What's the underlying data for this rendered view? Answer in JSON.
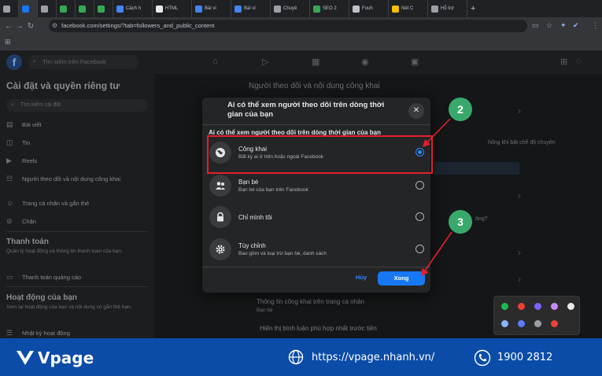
{
  "browser": {
    "tabs": [
      {
        "label": "",
        "color": "#9aa0a6"
      },
      {
        "label": "",
        "color": "#1877f2"
      },
      {
        "label": "",
        "color": "#9aa0a6"
      },
      {
        "label": "",
        "color": "#34a853"
      },
      {
        "label": "",
        "color": "#34a853"
      },
      {
        "label": "",
        "color": "#34a853"
      },
      {
        "label": "Cách h",
        "color": "#4285f4"
      },
      {
        "label": "HTML",
        "color": "#e8eaed"
      },
      {
        "label": "Bài vi",
        "color": "#4285f4"
      },
      {
        "label": "Bài vi",
        "color": "#4285f4"
      },
      {
        "label": "Chuyê",
        "color": "#9aa0a6"
      },
      {
        "label": "SEO 2",
        "color": "#34a853"
      },
      {
        "label": "Fouh",
        "color": "#bdc1c6"
      },
      {
        "label": "Nét C",
        "color": "#fbbc04"
      },
      {
        "label": "Hỗ trợ",
        "color": "#9aa0a6"
      }
    ],
    "new_tab": "+",
    "url": "facebook.com/settings/?tab=followers_and_public_content"
  },
  "fb": {
    "search_placeholder": "Tìm kiếm trên Facebook",
    "sidebar": {
      "title": "Cài đặt và quyền riêng tư",
      "search_placeholder": "Tìm kiếm cài đặt",
      "items": [
        "Bài viết",
        "Tin",
        "Reels",
        "Người theo dõi và nội dung công khai",
        "Trang cá nhân và gắn thẻ",
        "Chặn"
      ],
      "payments_head": "Thanh toán",
      "payments_sub": "Quản lý hoạt động và thông tin thanh toán của bạn.",
      "payments_item": "Thanh toán quảng cáo",
      "activity_head": "Hoạt động của bạn",
      "activity_sub": "Xem lại hoạt động của bạn và nội dung có gắn thẻ bạn.",
      "activity_item": "Nhật ký hoạt động"
    },
    "main": {
      "heading": "Người theo dõi và nội dung công khai",
      "bg_line1": "Thông tin công khai trên trang cá nhân",
      "bg_line2": "Bạn bè",
      "bg_line3": "Hiển thị bình luận phù hợp nhất trước tiên",
      "bg_right1": "hống khi bật chế độ chuyên",
      "bg_right2": "ông?"
    }
  },
  "modal": {
    "title": "Ai có thể xem người theo dõi trên dòng thời gian của bạn",
    "subtitle": "Ai có thể xem người theo dõi trên dòng thời gian của bạn",
    "close": "✕",
    "options": [
      {
        "title": "Công khai",
        "desc": "Bất kỳ ai ở trên hoặc ngoài Facebook",
        "selected": true,
        "icon": "globe-icon"
      },
      {
        "title": "Bạn bè",
        "desc": "Bạn bè của bạn trên Facebook",
        "selected": false,
        "icon": "friends-icon"
      },
      {
        "title": "Chỉ mình tôi",
        "desc": "",
        "selected": false,
        "icon": "lock-icon"
      },
      {
        "title": "Tùy chỉnh",
        "desc": "Bao gồm và loại trừ bạn bè, danh sách",
        "selected": false,
        "icon": "gear-icon"
      }
    ],
    "cancel": "Hủy",
    "done": "Xong"
  },
  "annotations": {
    "step_a": "2",
    "step_b": "3"
  },
  "banner": {
    "brand": "Vpage",
    "url": "https://vpage.nhanh.vn/",
    "phone": "1900 2812"
  }
}
